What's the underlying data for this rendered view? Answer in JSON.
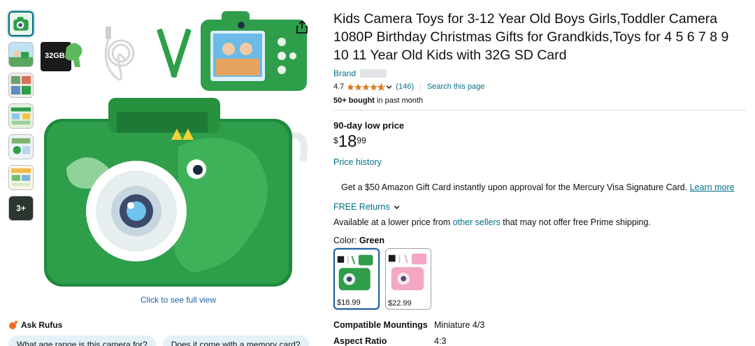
{
  "thumbnails": [
    {
      "name": "thumb-green-camera",
      "active": true
    },
    {
      "name": "thumb-camera-lifestyle-1",
      "active": false
    },
    {
      "name": "thumb-camera-lifestyle-2",
      "active": false
    },
    {
      "name": "thumb-camera-features",
      "active": false
    },
    {
      "name": "thumb-camera-lifestyle-3",
      "active": false
    },
    {
      "name": "thumb-camera-specs",
      "active": false
    },
    {
      "name": "thumb-video",
      "more_label": "3+"
    }
  ],
  "main_image": {
    "accessory_sd_label": "32GB"
  },
  "full_view_label": "Click to see full view",
  "rufus": {
    "label": "Ask Rufus",
    "chips": [
      "What age range is this camera for?",
      "Does it come with a memory card?"
    ]
  },
  "product": {
    "title": "Kids Camera Toys for 3-12 Year Old Boys Girls,Toddler Camera 1080P Birthday Christmas Gifts for Grandkids,Toys for 4 5 6 7 8 9 10 11 Year Old Kids with 32G SD Card",
    "brand_label": "Brand",
    "rating": "4.7",
    "rating_value": 4.7,
    "rating_count": "(146)",
    "search_link": "Search this page",
    "bought_bold": "50+ bought",
    "bought_rest": " in past month",
    "deal_label": "90-day low price",
    "price_symbol": "$",
    "price_whole": "18",
    "price_fraction": "99",
    "price_history": "Price history",
    "giftcard_text": "Get a $50 Amazon Gift Card instantly upon approval for the Mercury Visa Signature Card.",
    "giftcard_link": "Learn more",
    "returns_label": "FREE Returns",
    "lower_price_pre": "Available at a lower price from ",
    "lower_price_link": "other sellers",
    "lower_price_post": " that may not offer free Prime shipping.",
    "color_label": "Color:",
    "color_value": "Green",
    "swatches": [
      {
        "name": "green",
        "price": "$18.99",
        "selected": true
      },
      {
        "name": "pink",
        "price": "$22.99",
        "selected": false
      }
    ],
    "specs": [
      {
        "key": "Compatible Mountings",
        "value": "Miniature 4/3"
      },
      {
        "key": "Aspect Ratio",
        "value": "4:3"
      }
    ]
  },
  "colors": {
    "link": "#007185",
    "star": "#de7921",
    "camera_green": "#2e9e4a",
    "camera_dark": "#1d7a36"
  }
}
